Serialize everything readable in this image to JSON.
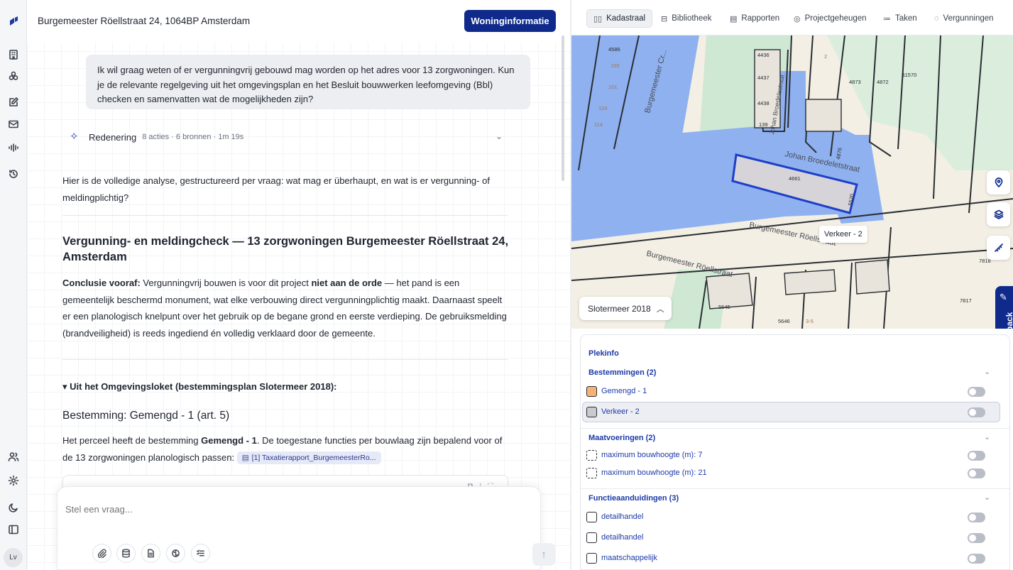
{
  "header": {
    "address": "Burgemeester Röellstraat 24, 1064BP Amsterdam",
    "woning_button": "Woninginformatie"
  },
  "rail": {
    "icons": [
      "logo-icon",
      "building-icon",
      "layers-icon",
      "edit-icon",
      "mail-icon",
      "waveform-icon",
      "history-icon",
      "users-icon",
      "settings-icon",
      "moon-icon",
      "sidebar-icon"
    ],
    "avatar": "Lv"
  },
  "chat": {
    "user_message": "Ik wil graag weten of er vergunningvrij gebouwd mag worden op het adres voor 13 zorgwoningen. Kun je de relevante regelgeving uit het omgevingsplan en het Besluit bouwwerken leefomgeving (Bbl) checken en samenvatten wat de mogelijkheden zijn?",
    "reasoning_label": "Redenering",
    "reasoning_meta": "8 acties · 6 bronnen · 1m 19s",
    "intro": "Hier is de volledige analyse, gestructureerd per vraag: wat mag er überhaupt, en wat is er vergunning- of meldingplichtig?",
    "heading": "Vergunning- en meldingcheck — 13 zorgwoningen Burgemeester Röellstraat 24, Amsterdam",
    "conclusion_label": "Conclusie vooraf:",
    "conclusion_a": " Vergunningvrij bouwen is voor dit project ",
    "conclusion_bold": "niet aan de orde",
    "conclusion_b": " — het pand is een gemeentelijk beschermd monument, wat elke verbouwing direct vergunningplichtig maakt. Daarnaast speelt er een planologisch knelpunt over het gebruik op de begane grond en eerste verdieping. De gebruiksmelding (brandveiligheid) is reeds ingediend én volledig verklaard door de gemeente.",
    "omgevingsloket_heading": "▾ Uit het Omgevingsloket (bestemmingsplan Slotermeer 2018):",
    "bestemming_heading": "Bestemming: Gemengd - 1 (art. 5)",
    "bestemming_a": "Het perceel heeft de bestemming ",
    "bestemming_bold": "Gemengd - 1",
    "bestemming_b": ". De toegestane functies per bouwlaag zijn bepalend voor of de 13 zorgwoningen planologisch passen: ",
    "citation": "[1] Taxatierapport_BurgemeesterRo...",
    "composer_placeholder": "Stel een vraag..."
  },
  "tabs": [
    {
      "icon": "map-icon",
      "label": "Kadastraal",
      "active": true
    },
    {
      "icon": "database-icon",
      "label": "Bibliotheek"
    },
    {
      "icon": "document-icon",
      "label": "Rapporten"
    },
    {
      "icon": "brain-icon",
      "label": "Projectgeheugen"
    },
    {
      "icon": "checklist-icon",
      "label": "Taken"
    },
    {
      "icon": "shield-check-icon",
      "label": "Vergunningen"
    }
  ],
  "map": {
    "street_labels": [
      "Burgemeester Röellstraat",
      "Johan Broedelet­straat",
      "Burgemeester Cr...",
      "Johan Broedelestraat",
      "Burgemeester Röellstraat"
    ],
    "parcel_numbers": [
      "4586",
      "165",
      "101",
      "124",
      "114",
      "4436",
      "4437",
      "4438",
      "139",
      "4873",
      "4872",
      "11570",
      "4661",
      "4876",
      "5520",
      "7818",
      "7817",
      "5645",
      "5646",
      "3-5",
      "2"
    ],
    "tooltip": "Verkeer - 2",
    "year_selector": "Slotermeer 2018",
    "feedback": "Feedback",
    "colors": {
      "water": "#8fb1f0",
      "selected_outline": "#1d3fc9",
      "ground": "#f3efe4"
    }
  },
  "plekinfo": {
    "title": "Plekinfo",
    "bestemmingen": {
      "label": "Bestemmingen (2)",
      "items": [
        {
          "label": "Gemengd - 1",
          "color": "#f6b274"
        },
        {
          "label": "Verkeer - 2",
          "color": "#c8cacf"
        }
      ]
    },
    "maatvoeringen": {
      "label": "Maatvoeringen (2)",
      "items": [
        {
          "label": "maximum bouwhoogte (m): 7"
        },
        {
          "label": "maximum bouwhoogte (m): 21"
        }
      ]
    },
    "functieaanduidingen": {
      "label": "Functieaanduidingen (3)",
      "items": [
        {
          "label": "detailhandel"
        },
        {
          "label": "detailhandel"
        },
        {
          "label": "maatschappelijk"
        }
      ]
    }
  }
}
